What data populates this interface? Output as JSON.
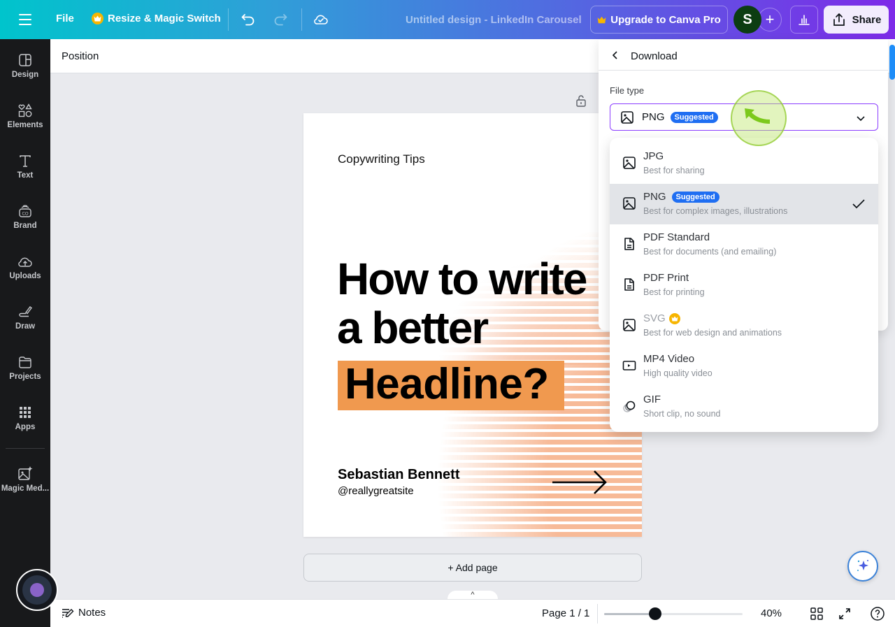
{
  "topbar": {
    "menu_icon": "hamburger-menu-icon",
    "file_label": "File",
    "resize_label": "Resize & Magic Switch",
    "document_title": "Untitled design - LinkedIn Carousel",
    "upgrade_label": "Upgrade to Canva Pro",
    "avatar_initial": "S",
    "add_collaborator_label": "+",
    "share_label": "Share"
  },
  "sidebar": {
    "items": [
      {
        "label": "Design",
        "icon": "layout-icon"
      },
      {
        "label": "Elements",
        "icon": "shapes-icon"
      },
      {
        "label": "Text",
        "icon": "text-icon"
      },
      {
        "label": "Brand",
        "icon": "brand-icon"
      },
      {
        "label": "Uploads",
        "icon": "cloud-upload-icon"
      },
      {
        "label": "Draw",
        "icon": "draw-icon"
      },
      {
        "label": "Projects",
        "icon": "folder-icon"
      },
      {
        "label": "Apps",
        "icon": "apps-grid-icon"
      },
      {
        "label": "Magic Med...",
        "icon": "magic-media-icon"
      }
    ]
  },
  "context_toolbar": {
    "position_label": "Position"
  },
  "canvas_page": {
    "kicker": "Copywriting Tips",
    "headline_line1": "How to write",
    "headline_line2": "a better",
    "headline_highlight": "Headline?",
    "author_name": "Sebastian Bennett",
    "author_handle": "@reallygreatsite",
    "highlight_color": "#f0994f"
  },
  "canvas": {
    "add_page_label": "+ Add page",
    "notes_toggle": "^"
  },
  "bottombar": {
    "notes_label": "Notes",
    "page_indicator": "Page 1 / 1",
    "zoom_percent": 40,
    "zoom_label": "40%",
    "zoom_slider_fraction": 0.37
  },
  "download_panel": {
    "title": "Download",
    "file_type_label": "File type",
    "selected_type": "PNG",
    "selected_badge": "Suggested",
    "options": [
      {
        "name": "JPG",
        "description": "Best for sharing",
        "icon": "image-icon",
        "selected": false,
        "badge": "",
        "pro": false
      },
      {
        "name": "PNG",
        "description": "Best for complex images, illustrations",
        "icon": "image-icon",
        "selected": true,
        "badge": "Suggested",
        "pro": false
      },
      {
        "name": "PDF Standard",
        "description": "Best for documents (and emailing)",
        "icon": "document-icon",
        "selected": false,
        "badge": "",
        "pro": false
      },
      {
        "name": "PDF Print",
        "description": "Best for printing",
        "icon": "document-icon",
        "selected": false,
        "badge": "",
        "pro": false
      },
      {
        "name": "SVG",
        "description": "Best for web design and animations",
        "icon": "image-icon",
        "selected": false,
        "badge": "",
        "pro": true
      },
      {
        "name": "MP4 Video",
        "description": "High quality video",
        "icon": "video-icon",
        "selected": false,
        "badge": "",
        "pro": false
      },
      {
        "name": "GIF",
        "description": "Short clip, no sound",
        "icon": "gif-icon",
        "selected": false,
        "badge": "",
        "pro": false
      }
    ]
  },
  "colors": {
    "accent_purple": "#8b3dff",
    "badge_blue": "#1f6ef2",
    "pro_gold": "#f7b500",
    "sidebar_bg": "#18191b"
  }
}
